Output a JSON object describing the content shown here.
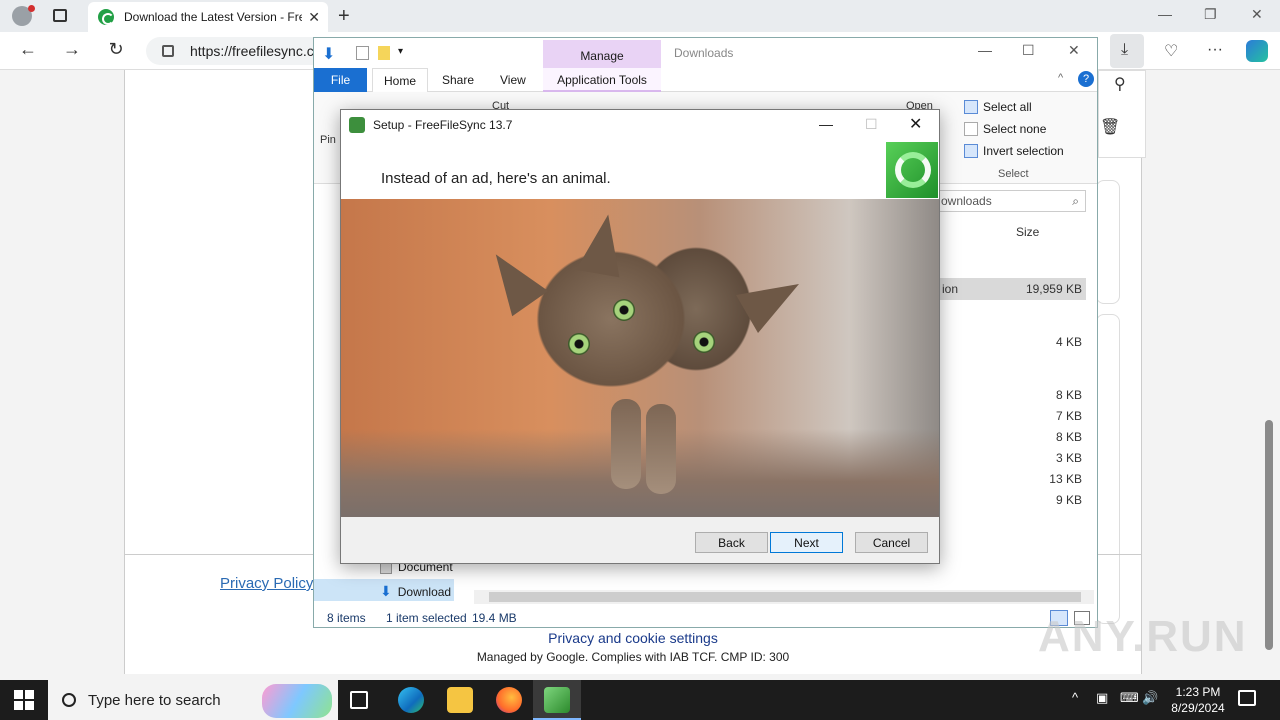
{
  "browser": {
    "tab_title": "Download the Latest Version - Fre",
    "url": "https://freefilesync.c",
    "controls": {
      "minimize": "—",
      "restore": "❐",
      "close": "✕"
    }
  },
  "page": {
    "privacy_link": "Privacy Policy",
    "privacy_settings": "Privacy and cookie settings",
    "managed_by": "Managed by Google. Complies with IAB TCF. CMP ID: 300"
  },
  "explorer": {
    "title": "Downloads",
    "manage_tab": "Manage",
    "tabs": {
      "file": "File",
      "home": "Home",
      "share": "Share",
      "view": "View",
      "app_tools": "Application Tools"
    },
    "ribbon": {
      "cut": "Cut",
      "pin": "Pin",
      "open": "Open",
      "select_all": "Select all",
      "select_none": "Select none",
      "invert_selection": "Invert selection",
      "select_group": "Select"
    },
    "search_placeholder": "ownloads",
    "column_size": "Size",
    "rows": [
      {
        "name_fragment": "ion",
        "size": "19,959 KB"
      },
      {
        "size": "4 KB"
      },
      {
        "size": "8 KB"
      },
      {
        "size": "7 KB"
      },
      {
        "size": "8 KB"
      },
      {
        "size": "3 KB"
      },
      {
        "size": "13 KB"
      },
      {
        "size": "9 KB"
      }
    ],
    "nav_items": {
      "documents": "Document",
      "downloads": "Download"
    },
    "status": {
      "items": "8 items",
      "selected": "1 item selected",
      "size": "19.4 MB"
    }
  },
  "dialog": {
    "title": "Setup - FreeFileSync 13.7",
    "message": "Instead of an ad, here's an animal.",
    "buttons": {
      "back": "Back",
      "next": "Next",
      "cancel": "Cancel"
    }
  },
  "watermark": "ANY.RUN",
  "taskbar": {
    "search_placeholder": "Type here to search",
    "time": "1:23 PM",
    "date": "8/29/2024"
  }
}
